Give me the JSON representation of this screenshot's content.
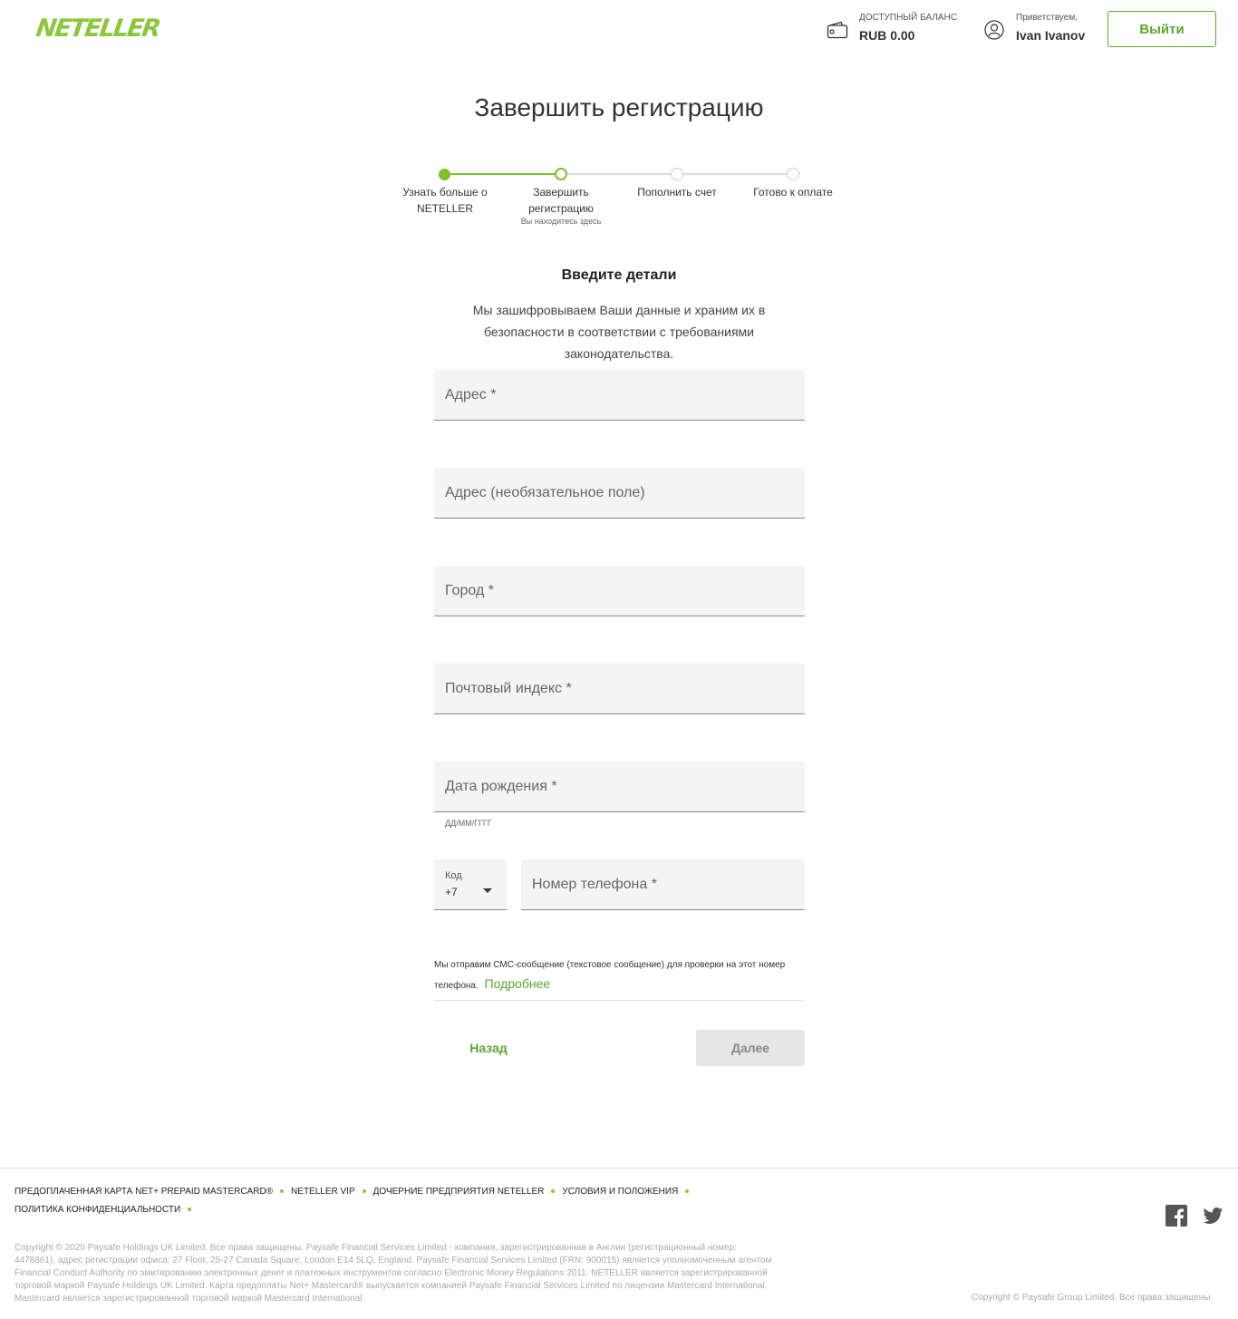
{
  "brand": {
    "logo_text": "NETELLER",
    "accent": "#8dc63f",
    "link_color": "#5da630"
  },
  "header": {
    "balance_label": "ДОСТУПНЫЙ БАЛАНС",
    "balance_value": "RUB 0.00",
    "greet_label": "Приветствуем,",
    "user_name": "Ivan Ivanov",
    "logout_label": "Выйти"
  },
  "page": {
    "title": "Завершить регистрацию"
  },
  "steps": [
    {
      "label": "Узнать больше о NETELLER",
      "state": "done"
    },
    {
      "label": "Завершить регистрацию",
      "state": "current",
      "sub": "Вы находитесь здесь"
    },
    {
      "label": "Пополнить счет",
      "state": "todo"
    },
    {
      "label": "Готово к оплате",
      "state": "todo"
    }
  ],
  "form": {
    "section_title": "Введите детали",
    "section_desc": "Мы зашифровываем Ваши данные и храним их в безопасности в соответствии с требованиями законодательства.",
    "address1_placeholder": "Адрес *",
    "address2_placeholder": "Адрес (необязательное поле)",
    "city_placeholder": "Город *",
    "postcode_placeholder": "Почтовый индекс *",
    "dob_placeholder": "Дата рождения *",
    "dob_hint": "ДД/ММ/ГГГГ",
    "code_label": "Код",
    "code_value": "+7",
    "phone_placeholder": "Номер телефона *",
    "sms_text": "Мы отправим СМС-сообщение (текстовое сообщение) для проверки на этот номер телефона.",
    "sms_link": "Подробнее",
    "back_label": "Назад",
    "next_label": "Далее"
  },
  "footer": {
    "links": [
      "ПРЕДОПЛАЧЕННАЯ КАРТА NET+ PREPAID MASTERCARD®",
      "NETELLER VIP",
      "ДОЧЕРНИЕ ПРЕДПРИЯТИЯ NETELLER",
      "УСЛОВИЯ И ПОЛОЖЕНИЯ",
      "ПОЛИТИКА КОНФИДЕНЦИАЛЬНОСТИ"
    ],
    "copyright_main": "Copyright © 2020 Paysafe Holdings UK Limited. Все права защищены. Paysafe Financial Services Limited - компания, зарегистрированная в Англии (регистрационный номер: 4478861), адрес регистрации офиса: 27 Floor, 25-27 Canada Square, London E14 5LQ, England. Paysafe Financial Services Limited (FRN: 900015) является уполномоченным агентом Financial Conduct Authority по эмитированию электронных денег и платежных инструментов согласно Electronic Money Regulations 2011. NETELLER является зарегистрированной торговой маркой Paysafe Holdings UK Limited. Карта предоплаты Net+ Mastercard® выпускается компанией Paysafe Financial Services Limited по лицензии Mastercard International. Mastercard является зарегистрированной торговой маркой Mastercard International.",
    "copyright_group": "Copyright © Paysafe Group Limited. Все права защищены.",
    "icons": [
      "facebook-icon",
      "twitter-icon"
    ]
  }
}
